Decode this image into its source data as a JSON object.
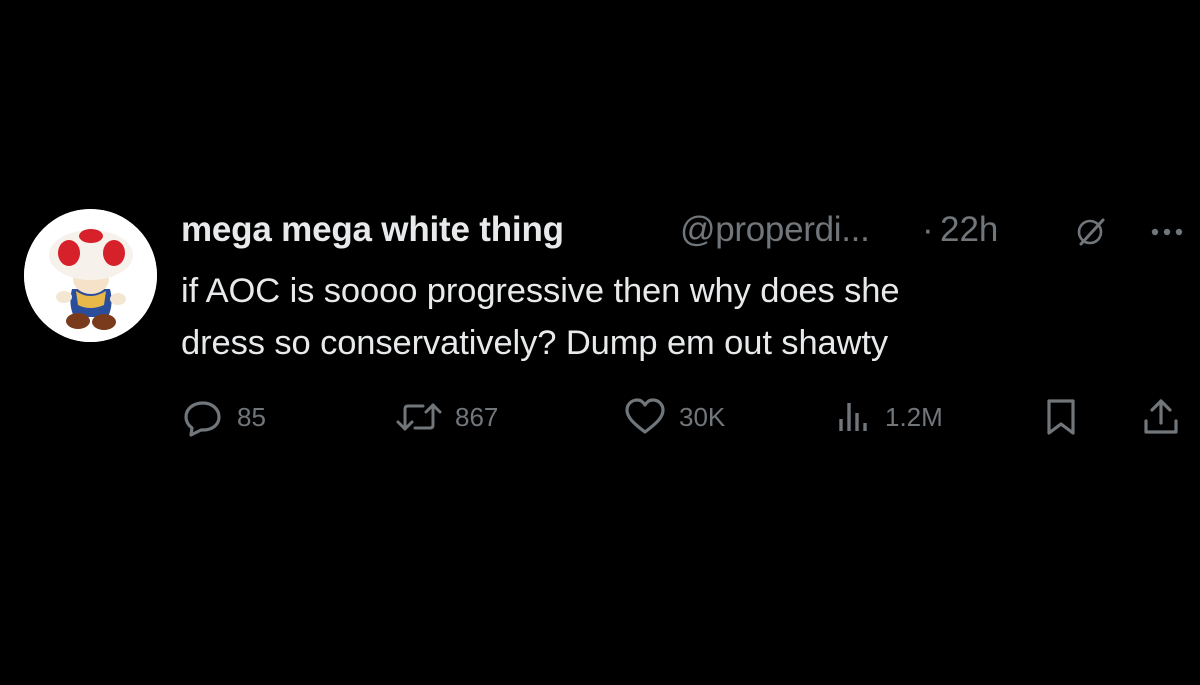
{
  "tweet": {
    "author": {
      "display_name": "mega mega white thing",
      "handle": "@properdi...",
      "avatar_icon": "toad-plush-avatar"
    },
    "separator": "·",
    "time": "22h",
    "header_icons": [
      "grok-icon",
      "more-options-icon"
    ],
    "text_lines": [
      "if AOC is soooo progressive then why does she",
      "dress so conservatively? Dump em out shawty"
    ],
    "actions": {
      "reply": {
        "icon": "reply-icon",
        "count": "85"
      },
      "retweet": {
        "icon": "retweet-icon",
        "count": "867"
      },
      "like": {
        "icon": "heart-icon",
        "count": "30K"
      },
      "views": {
        "icon": "views-chart-icon",
        "count": "1.2M"
      },
      "bookmark": {
        "icon": "bookmark-icon"
      },
      "share": {
        "icon": "share-icon"
      }
    }
  },
  "colors": {
    "background": "#000000",
    "primary_text": "#e7e9ea",
    "secondary_text": "#71767b"
  }
}
